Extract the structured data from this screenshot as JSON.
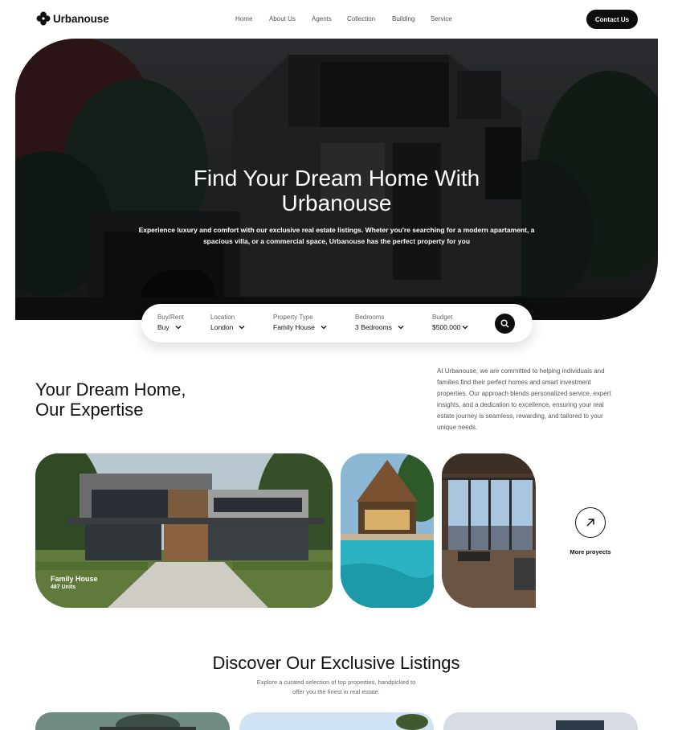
{
  "brand": {
    "name": "Urbanouse"
  },
  "nav": {
    "items": [
      {
        "label": "Home"
      },
      {
        "label": "About Us"
      },
      {
        "label": "Agents"
      },
      {
        "label": "Collection"
      },
      {
        "label": "Building"
      },
      {
        "label": "Service"
      }
    ],
    "contact_label": "Contact Us"
  },
  "hero": {
    "title_line1": "Find Your Dream Home With",
    "title_line2": "Urbanouse",
    "subtitle_line1": "Experience luxury and comfort with our exclusive real estate listings. Wheter you're searching for a modern apartament, a",
    "subtitle_line2": "spacious villa, or a commercial space, Urbanouse has the perfect property for you"
  },
  "search": {
    "fields": [
      {
        "label": "Buy/Rent",
        "value": "Buy"
      },
      {
        "label": "Location",
        "value": "London"
      },
      {
        "label": "Property Type",
        "value": "Family House"
      },
      {
        "label": "Bedrooms",
        "value": "3 Bedrooms"
      },
      {
        "label": "Budget",
        "value": "$500.000"
      }
    ],
    "button_icon": "search-icon"
  },
  "expertise": {
    "title_line1": "Your Dream Home,",
    "title_line2": "Our Expertise",
    "description_lines": [
      "At Urbanouse, we are committed to helping individuals and",
      "families find their perfect homes and smart investment",
      "properties. Our approach blends personalized service, expert",
      "insights, and a dedication to excellence, ensuring your real",
      "estate journey is seamless, rewarding, and tailored to your",
      "unique needs."
    ]
  },
  "projects": {
    "featured": {
      "name": "Family House",
      "units": "487 Units"
    },
    "more_label": "More proyects",
    "more_icon": "arrow-up-right-icon"
  },
  "listings": {
    "title": "Discover Our Exclusive Listings",
    "subtitle_line1": "Explore a curated selection of top properties, handpicked to",
    "subtitle_line2": "offer you the finest in real estate."
  },
  "colors": {
    "primary": "#0d0d0d",
    "text_muted": "#555555",
    "background": "#ffffff"
  }
}
